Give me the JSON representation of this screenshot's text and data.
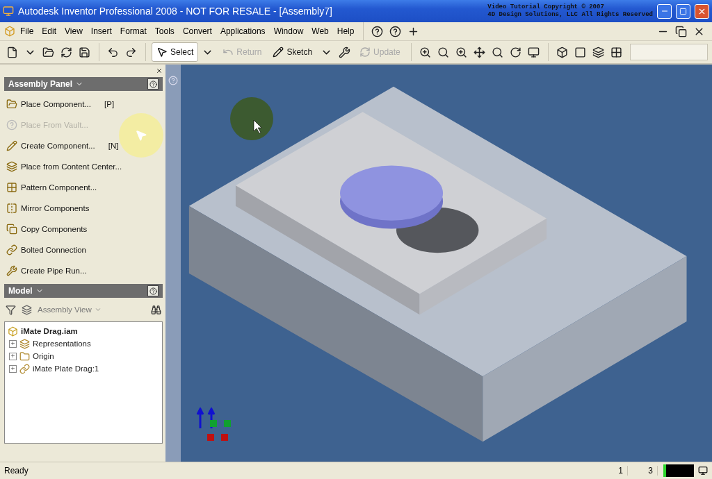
{
  "window": {
    "title": "Autodesk Inventor Professional 2008 - NOT FOR RESALE - [Assembly7]",
    "copyright": [
      "Video Tutorial Copyright © 2007",
      "4D Design Solutions, LLC All Rights Reserved"
    ]
  },
  "menu": [
    "File",
    "Edit",
    "View",
    "Insert",
    "Format",
    "Tools",
    "Convert",
    "Applications",
    "Window",
    "Web",
    "Help"
  ],
  "toolbar": [
    {
      "label": "Select",
      "selected": true,
      "disabled": false
    },
    {
      "label": "Return",
      "selected": false,
      "disabled": true
    },
    {
      "label": "Sketch",
      "selected": false,
      "disabled": false
    },
    {
      "label": "Update",
      "selected": false,
      "disabled": true
    }
  ],
  "assembly_panel": {
    "title": "Assembly Panel",
    "items": [
      {
        "label": "Place Component...",
        "shortcut": "[P]",
        "disabled": false
      },
      {
        "label": "Place From Vault...",
        "disabled": true
      },
      {
        "label": "Create Component...",
        "shortcut": "[N]",
        "disabled": false
      },
      {
        "label": "Place from Content Center...",
        "disabled": false
      },
      {
        "label": "Pattern Component...",
        "disabled": false
      },
      {
        "label": "Mirror Components",
        "disabled": false
      },
      {
        "label": "Copy Components",
        "disabled": false
      },
      {
        "label": "Bolted Connection",
        "disabled": false
      },
      {
        "label": "Create Pipe Run...",
        "disabled": false
      }
    ]
  },
  "model_panel": {
    "title": "Model",
    "view": "Assembly View",
    "tree": {
      "label": "iMate Drag.iam",
      "children": [
        {
          "label": "Representations",
          "expanded": false
        },
        {
          "label": "Origin",
          "expanded": false
        },
        {
          "label": "iMate Plate Drag:1",
          "expanded": false
        }
      ]
    }
  },
  "status_bar": {
    "text": "Ready",
    "cells": [
      "1",
      "3"
    ]
  }
}
